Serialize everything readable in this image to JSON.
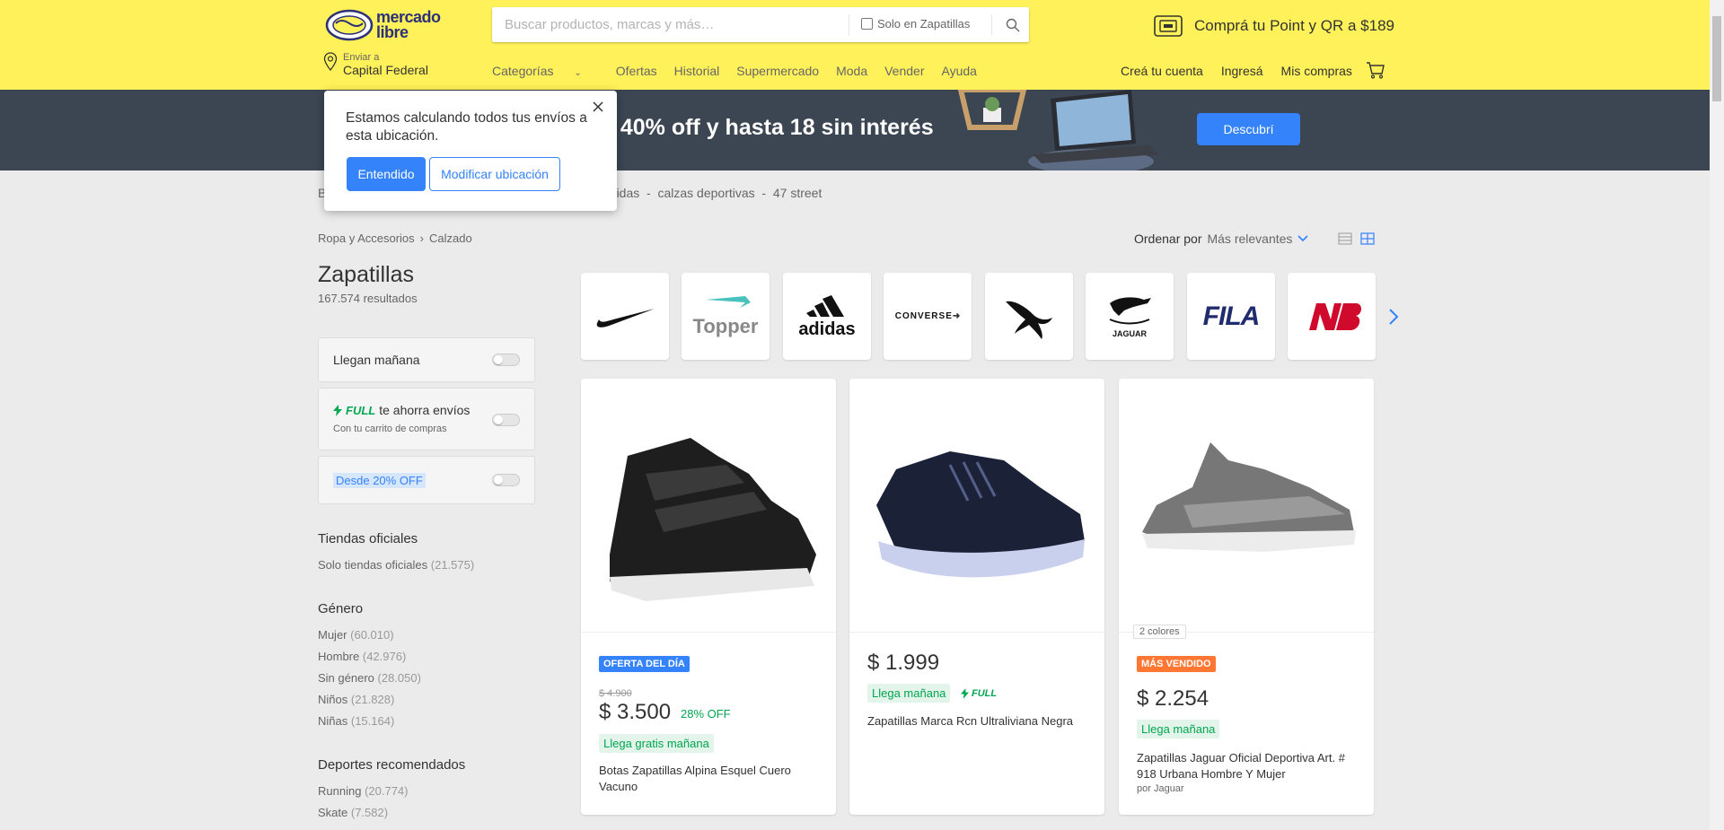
{
  "header": {
    "logo_line1": "mercado",
    "logo_line2": "libre",
    "search_placeholder": "Buscar productos, marcas y más…",
    "solo_label": "Solo en Zapatillas",
    "promo": "Comprá tu Point y QR a $189",
    "ship_label": "Enviar a",
    "ship_city": "Capital Federal",
    "nav": [
      "Categorías",
      "Ofertas",
      "Historial",
      "Supermercado",
      "Moda",
      "Vender",
      "Ayuda"
    ],
    "right_nav": [
      "Creá tu cuenta",
      "Ingresá",
      "Mis compras"
    ]
  },
  "banner": {
    "text": "a 40% off y hasta 18 sin interés",
    "button": "Descubrí"
  },
  "popover": {
    "text": "Estamos calculando todos tus envíos a esta ubicación.",
    "ok": "Entendido",
    "modify": "Modificar ubicación"
  },
  "related": {
    "label": "B",
    "items": "adidas  -  calzas deportivas  -  47 street"
  },
  "breadcrumb": [
    "Ropa y Accesorios",
    "Calzado"
  ],
  "sort": {
    "label": "Ordenar por",
    "value": "Más relevantes"
  },
  "page": {
    "title": "Zapatillas",
    "count": "167.574 resultados"
  },
  "filters": {
    "llegan": "Llegan mañana",
    "full_brand": "FULL",
    "full_text": "te ahorra envíos",
    "full_sub": "Con tu carrito de compras",
    "desde": "Desde 20% OFF",
    "tiendas_title": "Tiendas oficiales",
    "tiendas": [
      {
        "label": "Solo tiendas oficiales",
        "n": "(21.575)"
      }
    ],
    "genero_title": "Género",
    "genero": [
      {
        "label": "Mujer",
        "n": "(60.010)"
      },
      {
        "label": "Hombre",
        "n": "(42.976)"
      },
      {
        "label": "Sin género",
        "n": "(28.050)"
      },
      {
        "label": "Niños",
        "n": "(21.828)"
      },
      {
        "label": "Niñas",
        "n": "(15.164)"
      }
    ],
    "deportes_title": "Deportes recomendados",
    "deportes": [
      {
        "label": "Running",
        "n": "(20.774)"
      },
      {
        "label": "Skate",
        "n": "(7.582)"
      }
    ]
  },
  "brands": [
    "Nike",
    "Topper",
    "adidas",
    "CONVERSE",
    "Puma",
    "JAGUAR",
    "FILA",
    "New Balance"
  ],
  "products": [
    {
      "tag": "OFERTA DEL DÍA",
      "old": "$ 4.900",
      "price": "$ 3.500",
      "off": "28% OFF",
      "ship": "Llega gratis mañana",
      "title": "Botas Zapatillas Alpina Esquel Cuero Vacuno",
      "by": ""
    },
    {
      "tag": "",
      "old": "",
      "price": "$ 1.999",
      "off": "",
      "ship": "Llega mañana",
      "full": "FULL",
      "title": "Zapatillas Marca Rcn Ultraliviana Negra",
      "by": ""
    },
    {
      "colors": "2 colores",
      "tag": "MÁS VENDIDO",
      "old": "",
      "price": "$ 2.254",
      "off": "",
      "ship": "Llega mañana",
      "title": "Zapatillas Jaguar Oficial Deportiva Art. # 918 Urbana Hombre Y Mujer",
      "by": "por Jaguar"
    }
  ],
  "colors": {
    "yellow": "#fff159",
    "blue": "#3483fa",
    "green": "#00a650",
    "orange": "#f73",
    "tag_blue": "#3483fa"
  }
}
